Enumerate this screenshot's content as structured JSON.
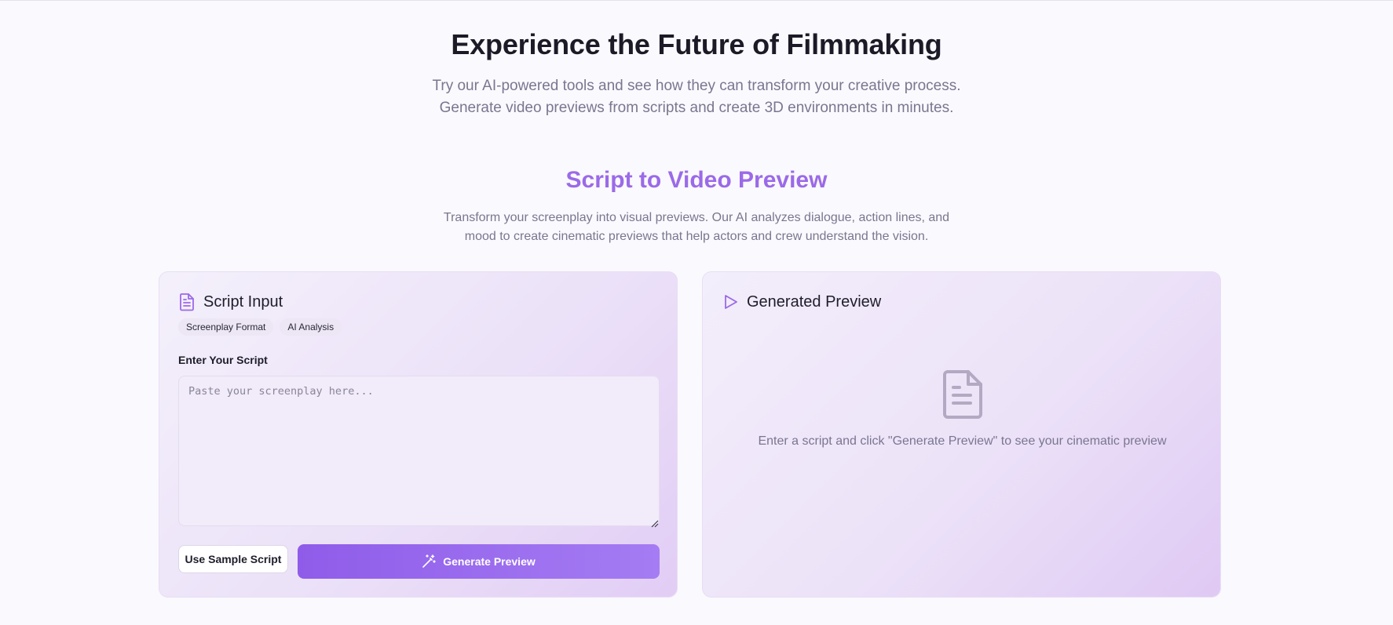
{
  "hero": {
    "title": "Experience the Future of Filmmaking",
    "subtitle_line1": "Try our AI-powered tools and see how they can transform your creative process.",
    "subtitle_line2": "Generate video previews from scripts and create 3D environments in minutes."
  },
  "section": {
    "title": "Script to Video Preview",
    "desc_line1": "Transform your screenplay into visual previews. Our AI analyzes dialogue, action lines, and",
    "desc_line2": "mood to create cinematic previews that help actors and crew understand the vision."
  },
  "script_input": {
    "title": "Script Input",
    "icon": "document-icon",
    "tags": [
      "Screenplay Format",
      "AI Analysis"
    ],
    "field_label": "Enter Your Script",
    "placeholder": "Paste your screenplay here...",
    "value": "",
    "sample_button": "Use Sample Script",
    "generate_button": "Generate Preview"
  },
  "preview": {
    "title": "Generated Preview",
    "icon": "play-icon",
    "empty_icon": "document-icon",
    "empty_text": "Enter a script and click \"Generate Preview\" to see your cinematic preview"
  },
  "colors": {
    "accent": "#9b6ae8",
    "button_gradient_start": "#8f5ce9",
    "button_gradient_end": "#a57cf3",
    "muted_text": "#7a7690"
  }
}
